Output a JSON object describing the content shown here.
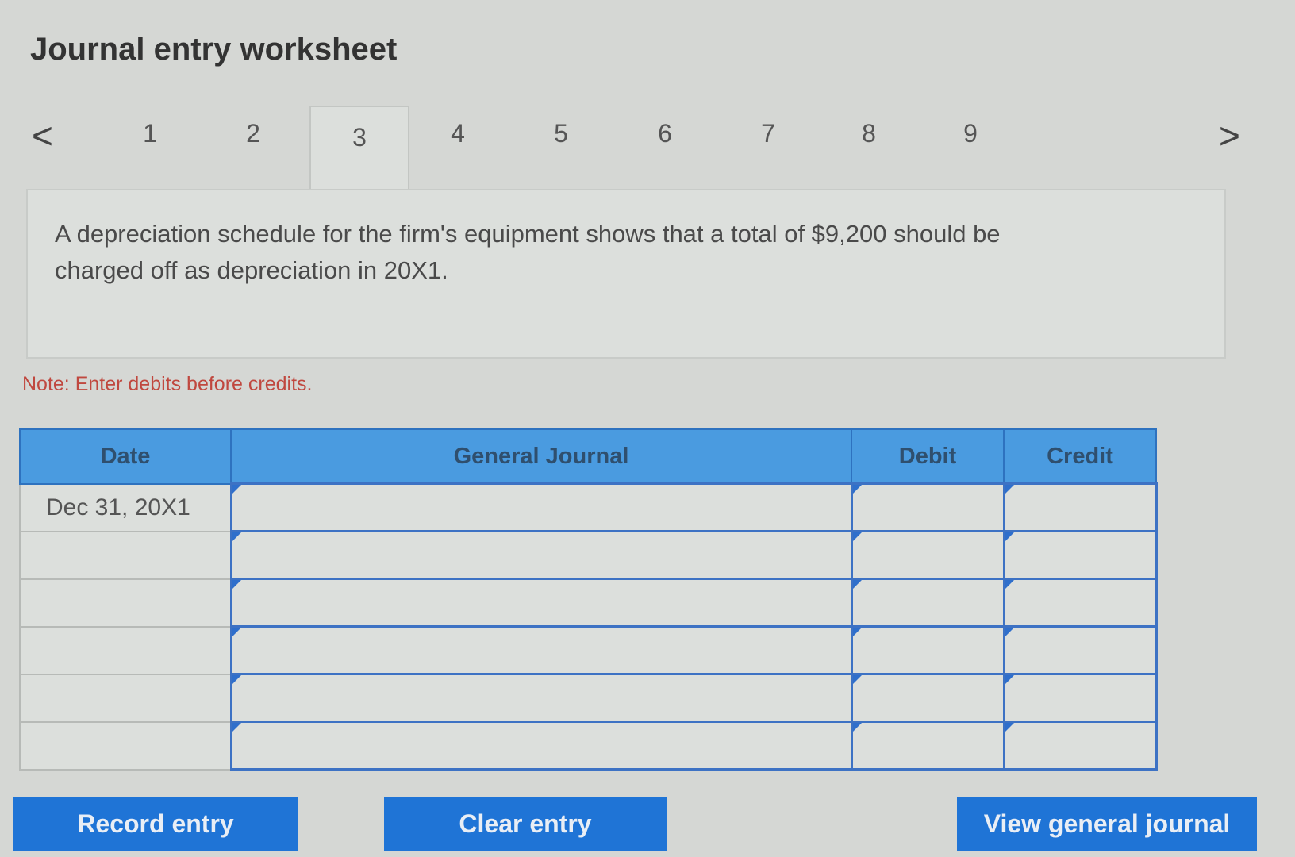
{
  "worksheet": {
    "title": "Journal entry worksheet",
    "tabs": [
      "1",
      "2",
      "3",
      "4",
      "5",
      "6",
      "7",
      "8",
      "9"
    ],
    "active_tab": "3",
    "prev_arrow": "<",
    "next_arrow": ">"
  },
  "problem": {
    "text_line1": "A depreciation schedule for the firm's equipment shows that a total of $9,200 should be",
    "text_line2": "charged off as depreciation in 20X1."
  },
  "note": "Note: Enter debits before credits.",
  "table": {
    "headers": {
      "date": "Date",
      "general_journal": "General Journal",
      "debit": "Debit",
      "credit": "Credit"
    },
    "rows": [
      {
        "date": "Dec 31, 20X1"
      },
      {
        "date": ""
      },
      {
        "date": ""
      },
      {
        "date": ""
      },
      {
        "date": ""
      },
      {
        "date": ""
      }
    ]
  },
  "buttons": {
    "record": "Record entry",
    "clear": "Clear entry",
    "view": "View general journal"
  }
}
